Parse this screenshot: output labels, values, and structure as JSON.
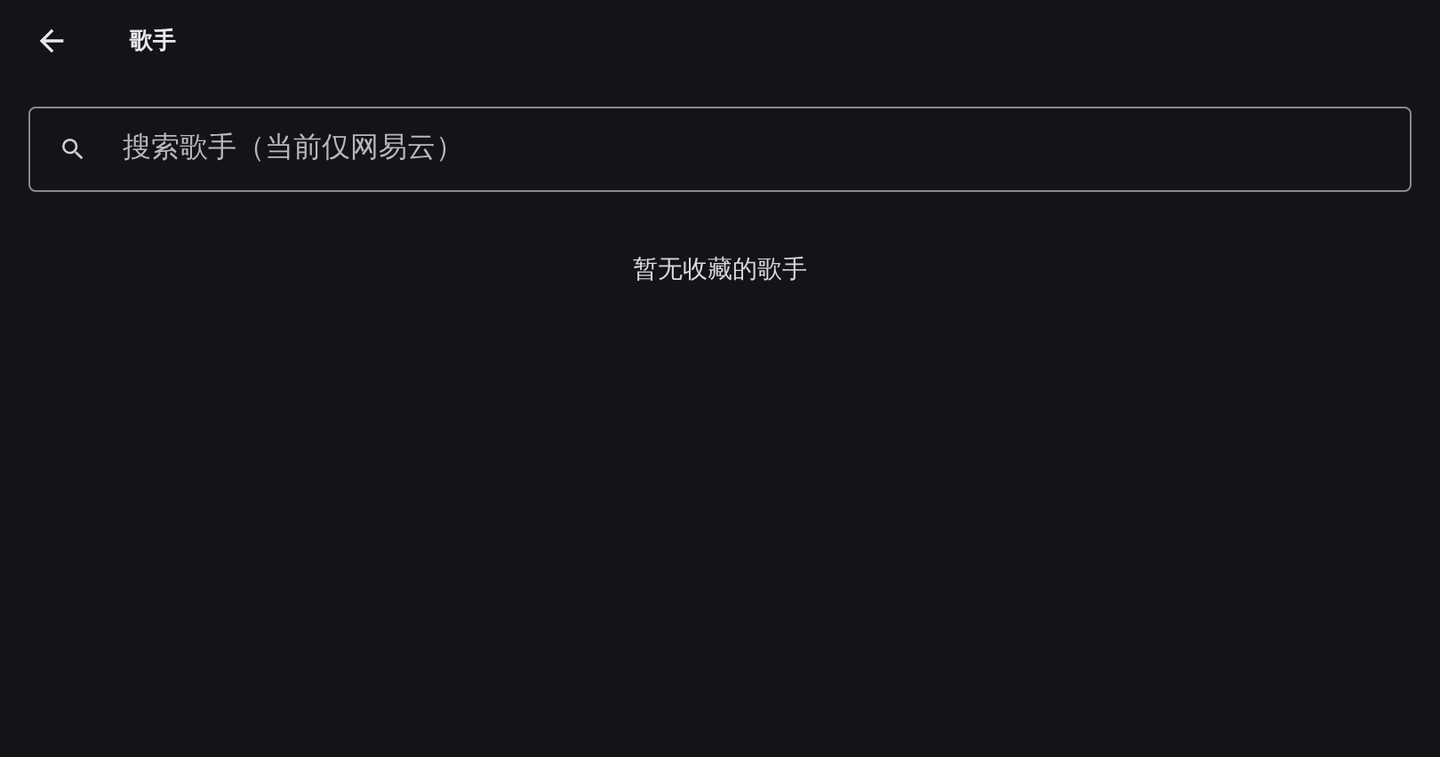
{
  "header": {
    "title": "歌手"
  },
  "search": {
    "placeholder": "搜索歌手（当前仅网易云）"
  },
  "empty_message": "暂无收藏的歌手"
}
